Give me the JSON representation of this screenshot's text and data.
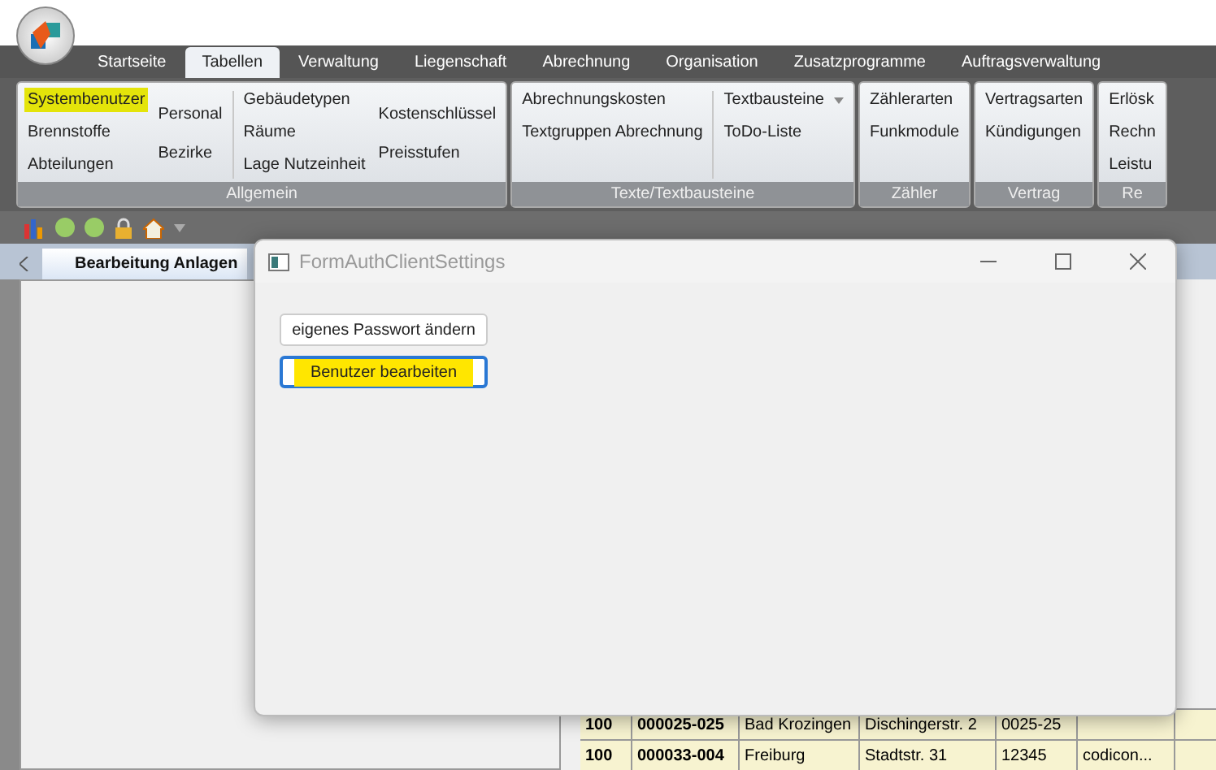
{
  "app_tabs": [
    {
      "label": "Startseite",
      "selected": false
    },
    {
      "label": "Tabellen",
      "selected": true
    },
    {
      "label": "Verwaltung",
      "selected": false
    },
    {
      "label": "Liegenschaft",
      "selected": false
    },
    {
      "label": "Abrechnung",
      "selected": false
    },
    {
      "label": "Organisation",
      "selected": false
    },
    {
      "label": "Zusatzprogramme",
      "selected": false
    },
    {
      "label": "Auftragsverwaltung",
      "selected": false
    }
  ],
  "ribbon_groups": [
    {
      "title": "Allgemein",
      "sections": [
        [
          [
            {
              "label": "Systembenutzer",
              "highlighted": true,
              "kind": "button"
            },
            {
              "label": "Brennstoffe",
              "highlighted": false,
              "kind": "button"
            },
            {
              "label": "Abteilungen",
              "highlighted": false,
              "kind": "button"
            }
          ],
          [
            {
              "label": "Personal",
              "highlighted": false,
              "kind": "button"
            },
            {
              "label": "Bezirke",
              "highlighted": false,
              "kind": "button"
            }
          ]
        ],
        [
          [
            {
              "label": "Gebäudetypen",
              "highlighted": false,
              "kind": "button"
            },
            {
              "label": "Räume",
              "highlighted": false,
              "kind": "button"
            },
            {
              "label": "Lage Nutzeinheit",
              "highlighted": false,
              "kind": "button"
            }
          ],
          [
            {
              "label": "Kostenschlüssel",
              "highlighted": false,
              "kind": "button"
            },
            {
              "label": "Preisstufen",
              "highlighted": false,
              "kind": "button"
            }
          ]
        ]
      ]
    },
    {
      "title": "Texte/Textbausteine",
      "sections": [
        [
          [
            {
              "label": "Abrechnungskosten",
              "highlighted": false,
              "kind": "button"
            },
            {
              "label": "Textgruppen Abrechnung",
              "highlighted": false,
              "kind": "button"
            }
          ]
        ],
        [
          [
            {
              "label": "Textbausteine",
              "highlighted": false,
              "kind": "dropdown"
            },
            {
              "label": "ToDo-Liste",
              "highlighted": false,
              "kind": "button"
            }
          ]
        ]
      ]
    },
    {
      "title": "Zähler",
      "sections": [
        [
          [
            {
              "label": "Zählerarten",
              "highlighted": false,
              "kind": "button"
            },
            {
              "label": "Funkmodule",
              "highlighted": false,
              "kind": "button"
            }
          ]
        ]
      ]
    },
    {
      "title": "Vertrag",
      "sections": [
        [
          [
            {
              "label": "Vertragsarten",
              "highlighted": false,
              "kind": "button"
            },
            {
              "label": "Kündigungen",
              "highlighted": false,
              "kind": "button"
            }
          ]
        ]
      ]
    },
    {
      "title": "Re",
      "sections": [
        [
          [
            {
              "label": "Erlösk",
              "highlighted": false,
              "kind": "button"
            },
            {
              "label": "Rechn",
              "highlighted": false,
              "kind": "button"
            },
            {
              "label": "Leistu",
              "highlighted": false,
              "kind": "button"
            }
          ]
        ]
      ]
    }
  ],
  "document_tabs": [
    {
      "label": "Bearbeitung Anlagen",
      "selected": true
    }
  ],
  "table": {
    "rows": [
      {
        "cells": [
          "100",
          "000025-025",
          "Bad Krozingen",
          "Dischingerstr. 2",
          "0025-25",
          ""
        ]
      },
      {
        "cells": [
          "100",
          "000033-004",
          "Freiburg",
          "Stadtstr. 31",
          "12345",
          "codicon..."
        ]
      }
    ]
  },
  "dialog": {
    "title": "FormAuthClientSettings",
    "buttons": [
      {
        "label": "eigenes Passwort ändern",
        "focused": false,
        "highlighted": false
      },
      {
        "label": "Benutzer bearbeiten",
        "focused": true,
        "highlighted": true
      }
    ]
  }
}
